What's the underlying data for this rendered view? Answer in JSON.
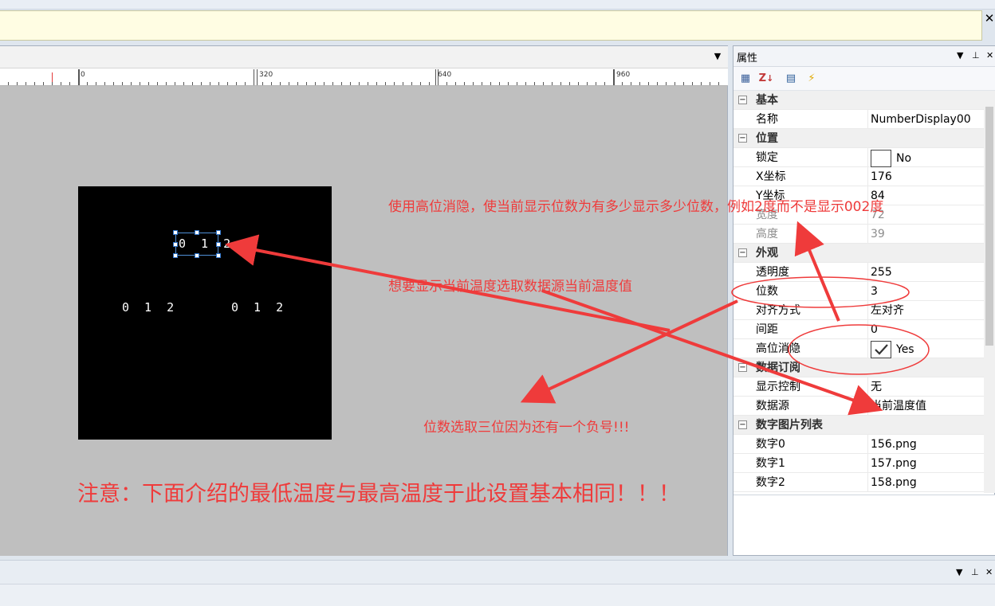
{
  "notice": {
    "close": "✕"
  },
  "ruler": {
    "labels": [
      "0",
      "320",
      "640",
      "960"
    ]
  },
  "screen": {
    "selected_digits": "0 1 2",
    "digits_left": "0 1 2",
    "digits_right": "0 1 2"
  },
  "annotations": {
    "leading_zero": "使用高位消隐，使当前显示位数为有多少显示多少位数，例如2度而不是显示002度",
    "data_source": "想要显示当前温度选取数据源当前温度值",
    "digits": "位数选取三位因为还有一个负号!!!",
    "note": "注意：下面介绍的最低温度与最高温度于此设置基本相同！！！"
  },
  "properties": {
    "title": "属性",
    "header_icons": {
      "dropdown": "▼",
      "pin": "⊥",
      "close": "✕"
    },
    "toolbar": {
      "categorized": "▦",
      "sort": "↓",
      "pages": "▤",
      "events": "⚡"
    },
    "sections": {
      "basic": "基本",
      "position": "位置",
      "appearance": "外观",
      "subscribe": "数据订阅",
      "images": "数字图片列表"
    },
    "rows": {
      "name": {
        "key": "名称",
        "value": "NumberDisplay00"
      },
      "lock": {
        "key": "锁定",
        "value": "No"
      },
      "x": {
        "key": "X坐标",
        "value": "176"
      },
      "y": {
        "key": "Y坐标",
        "value": "84"
      },
      "width": {
        "key": "宽度",
        "value": "72"
      },
      "height": {
        "key": "高度",
        "value": "39"
      },
      "opacity": {
        "key": "透明度",
        "value": "255"
      },
      "digits": {
        "key": "位数",
        "value": "3"
      },
      "align": {
        "key": "对齐方式",
        "value": "左对齐"
      },
      "spacing": {
        "key": "间距",
        "value": "0"
      },
      "leading_zero": {
        "key": "高位消隐",
        "value": "Yes"
      },
      "display_control": {
        "key": "显示控制",
        "value": "无"
      },
      "data_source": {
        "key": "数据源",
        "value": "当前温度值"
      },
      "digit0": {
        "key": "数字0",
        "value": "156.png"
      },
      "digit1": {
        "key": "数字1",
        "value": "157.png"
      },
      "digit2": {
        "key": "数字2",
        "value": "158.png"
      }
    }
  },
  "bottom_panel": {
    "dropdown": "▼",
    "pin": "⊥",
    "close": "✕"
  },
  "colors": {
    "annotation": "#ef3b3b",
    "canvas": "#bfbfbf",
    "screen": "#000000",
    "notice": "#fffde3"
  }
}
